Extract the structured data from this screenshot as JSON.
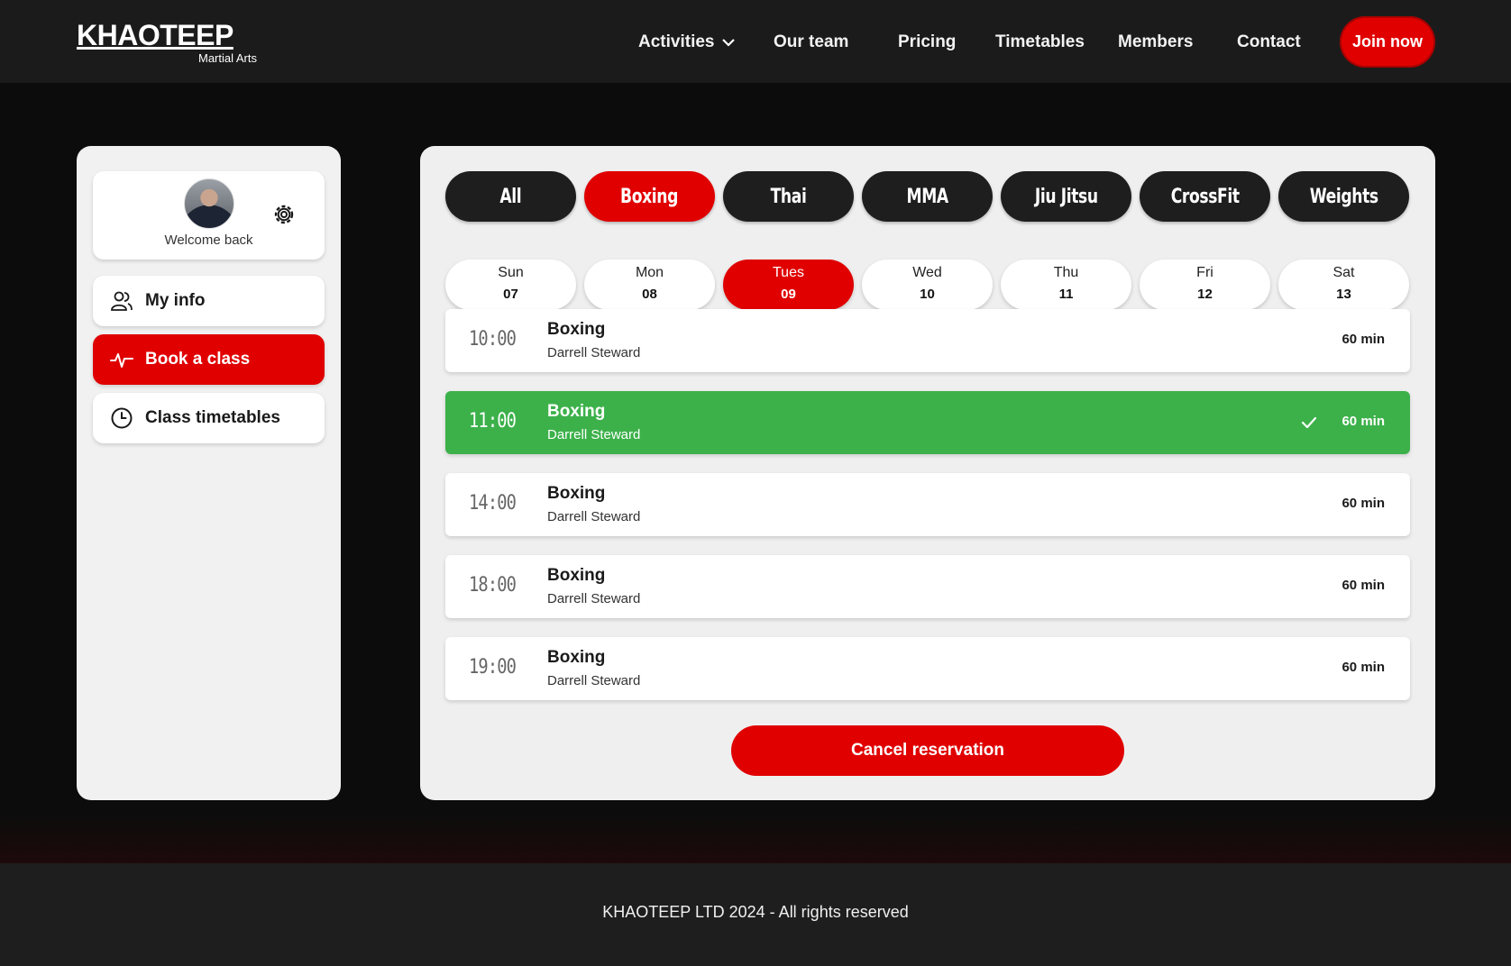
{
  "brand": {
    "name": "KHAOTEEP",
    "subtitle": "Martial Arts"
  },
  "nav": {
    "items": [
      {
        "label": "Activities",
        "has_dropdown": true
      },
      {
        "label": "Our team"
      },
      {
        "label": "Pricing"
      },
      {
        "label": "Timetables"
      },
      {
        "label": "Members"
      },
      {
        "label": "Contact"
      }
    ],
    "cta_label": "Join now"
  },
  "sidebar": {
    "welcome_text": "Welcome back",
    "items": [
      {
        "label": "My info",
        "icon": "users-icon",
        "active": false
      },
      {
        "label": "Book a class",
        "icon": "activity-icon",
        "active": true
      },
      {
        "label": "Class timetables",
        "icon": "clock-icon",
        "active": false
      }
    ]
  },
  "categories": [
    {
      "label": "All",
      "active": false
    },
    {
      "label": "Boxing",
      "active": true
    },
    {
      "label": "Thai",
      "active": false
    },
    {
      "label": "MMA",
      "active": false
    },
    {
      "label": "Jiu Jitsu",
      "active": false
    },
    {
      "label": "CrossFit",
      "active": false
    },
    {
      "label": "Weights",
      "active": false
    }
  ],
  "days": [
    {
      "name": "Sun",
      "date": "07",
      "active": false
    },
    {
      "name": "Mon",
      "date": "08",
      "active": false
    },
    {
      "name": "Tues",
      "date": "09",
      "active": true
    },
    {
      "name": "Wed",
      "date": "10",
      "active": false
    },
    {
      "name": "Thu",
      "date": "11",
      "active": false
    },
    {
      "name": "Fri",
      "date": "12",
      "active": false
    },
    {
      "name": "Sat",
      "date": "13",
      "active": false
    }
  ],
  "classes": [
    {
      "time": "10:00",
      "name": "Boxing",
      "coach": "Darrell Steward",
      "duration": "60 min",
      "booked": false
    },
    {
      "time": "11:00",
      "name": "Boxing",
      "coach": "Darrell Steward",
      "duration": "60 min",
      "booked": true
    },
    {
      "time": "14:00",
      "name": "Boxing",
      "coach": "Darrell Steward",
      "duration": "60 min",
      "booked": false
    },
    {
      "time": "18:00",
      "name": "Boxing",
      "coach": "Darrell Steward",
      "duration": "60 min",
      "booked": false
    },
    {
      "time": "19:00",
      "name": "Boxing",
      "coach": "Darrell Steward",
      "duration": "60 min",
      "booked": false
    }
  ],
  "cancel_label": "Cancel reservation",
  "footer_text": "KHAOTEEP LTD 2024 - All rights reserved",
  "colors": {
    "accent": "#e00000",
    "booked": "#3cb14a",
    "dark": "#1e1e1e"
  }
}
